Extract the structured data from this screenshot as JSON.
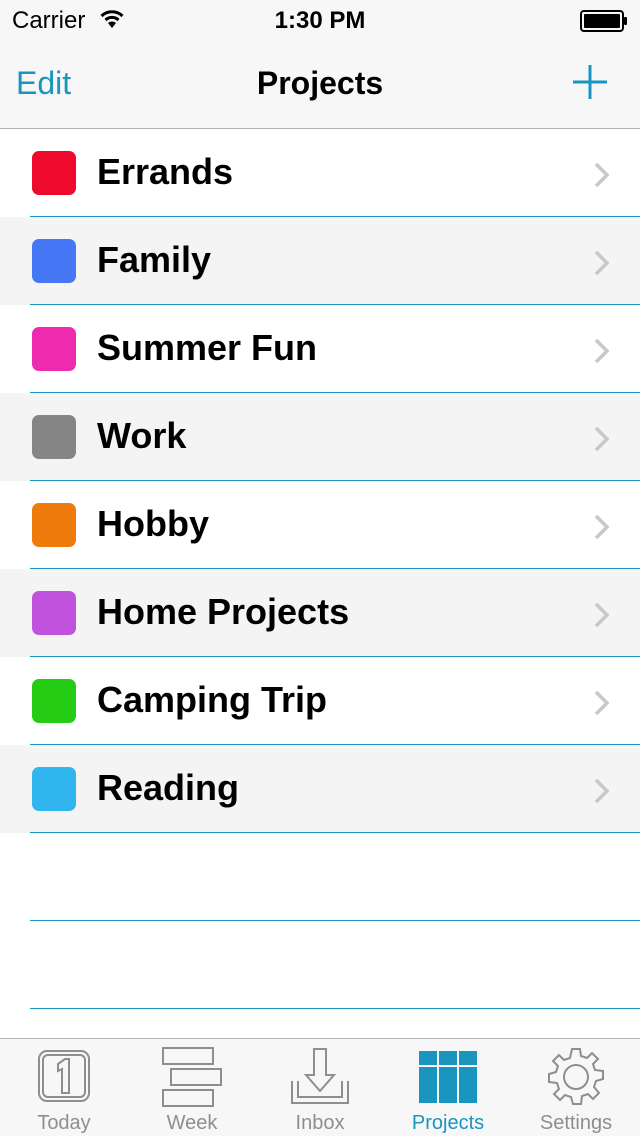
{
  "status_bar": {
    "carrier": "Carrier",
    "time": "1:30 PM"
  },
  "nav": {
    "edit_label": "Edit",
    "title": "Projects",
    "add_icon": "plus-icon"
  },
  "projects": [
    {
      "label": "Errands",
      "color": "#ee0a2c"
    },
    {
      "label": "Family",
      "color": "#4678f6"
    },
    {
      "label": "Summer Fun",
      "color": "#ee2bae"
    },
    {
      "label": "Work",
      "color": "#858585"
    },
    {
      "label": "Hobby",
      "color": "#ee7b0c"
    },
    {
      "label": "Home Projects",
      "color": "#c052dd"
    },
    {
      "label": "Camping Trip",
      "color": "#24cc14"
    },
    {
      "label": "Reading",
      "color": "#31b5ee"
    }
  ],
  "tabs": [
    {
      "label": "Today",
      "icon": "calendar-day-icon",
      "active": false
    },
    {
      "label": "Week",
      "icon": "week-icon",
      "active": false
    },
    {
      "label": "Inbox",
      "icon": "inbox-icon",
      "active": false
    },
    {
      "label": "Projects",
      "icon": "projects-grid-icon",
      "active": true
    },
    {
      "label": "Settings",
      "icon": "gear-icon",
      "active": false
    }
  ],
  "colors": {
    "accent": "#1a95c0",
    "inactive": "#8e8e8e"
  }
}
